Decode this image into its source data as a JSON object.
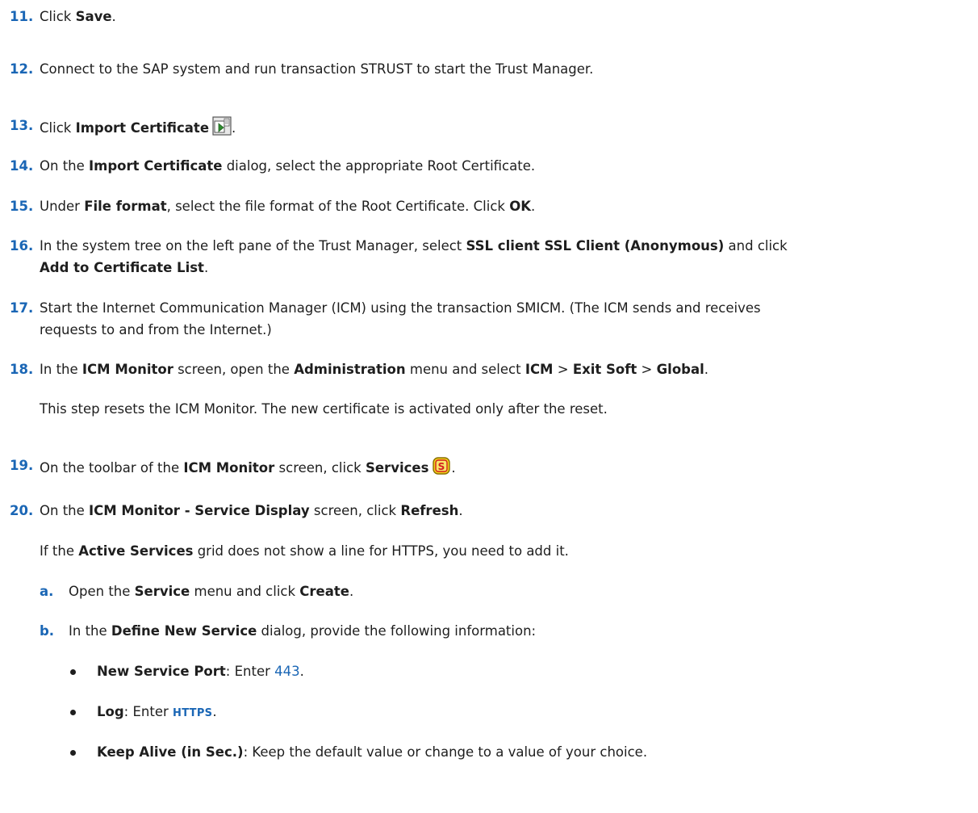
{
  "steps": [
    {
      "num": "11.",
      "parts": [
        "Click ",
        "Save",
        "."
      ]
    },
    {
      "num": "12.",
      "text": "Connect to the SAP system and run transaction STRUST to start the Trust Manager."
    },
    {
      "num": "13.",
      "parts": [
        "Click ",
        "Import Certificate",
        "."
      ],
      "icon": "import-certificate-icon"
    },
    {
      "num": "14.",
      "parts": [
        "On the ",
        "Import Certificate",
        " dialog, select the appropriate Root Certificate."
      ]
    },
    {
      "num": "15.",
      "parts": [
        "Under ",
        "File format",
        ", select the file format of the Root Certificate. Click ",
        "OK",
        "."
      ]
    },
    {
      "num": "16.",
      "parts": [
        "In the system tree on the left pane of the Trust Manager, select ",
        "SSL client SSL Client (Anonymous)",
        " and click",
        "Add to Certificate List",
        "."
      ]
    },
    {
      "num": "17.",
      "lines": [
        "Start the Internet Communication Manager (ICM) using the transaction SMICM. (The ICM sends and receives",
        "requests to and from the Internet.)"
      ]
    },
    {
      "num": "18.",
      "parts": [
        "In the ",
        "ICM Monitor",
        " screen, open the ",
        "Administration",
        " menu and select ",
        "ICM",
        " > ",
        "Exit Soft",
        " > ",
        "Global",
        "."
      ],
      "note": "This step resets the ICM Monitor. The new certificate is activated only after the reset."
    },
    {
      "num": "19.",
      "parts": [
        "On the toolbar of the ",
        "ICM Monitor",
        " screen, click ",
        "Services",
        "."
      ],
      "icon": "services-icon"
    },
    {
      "num": "20.",
      "parts": [
        "On the ",
        "ICM Monitor - Service Display",
        " screen, click ",
        "Refresh",
        "."
      ],
      "note_parts": [
        "If the ",
        "Active Services",
        " grid does not show a line for HTTPS, you need to add it."
      ]
    }
  ],
  "substeps": [
    {
      "num": "a.",
      "parts": [
        "Open the ",
        "Service",
        " menu and click ",
        "Create",
        "."
      ]
    },
    {
      "num": "b.",
      "parts": [
        "In the ",
        "Define New Service",
        " dialog, provide the following information:"
      ]
    }
  ],
  "bullets": [
    {
      "parts": [
        "New Service Port",
        ": Enter ",
        "443",
        "."
      ]
    },
    {
      "parts": [
        "Log",
        ": Enter ",
        "HTTPS",
        "."
      ]
    },
    {
      "parts": [
        "Keep Alive (in Sec.)",
        ": Keep the default value or change to a value of your choice."
      ]
    }
  ],
  "colors": {
    "accent": "#1a66b5",
    "text": "#1e1e1e",
    "icon_green": "#2e8b2e",
    "icon_yellow": "#f2d21a",
    "icon_red": "#d42020"
  }
}
